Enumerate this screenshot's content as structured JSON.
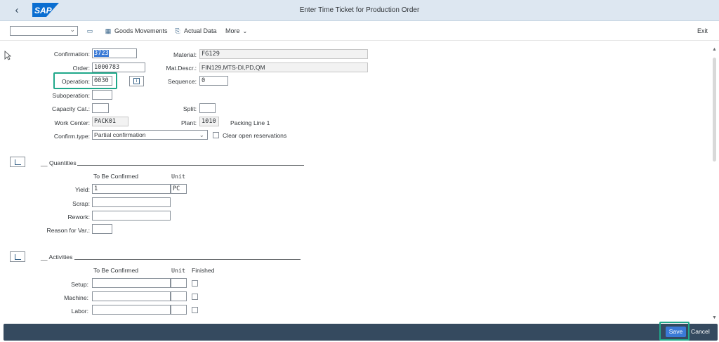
{
  "shell": {
    "title": "Enter Time Ticket for Production Order",
    "logo_text": "SAP",
    "brand_color": "#0a6ed1",
    "back_icon": "back-arrow-icon"
  },
  "toolbar": {
    "variant_value": "",
    "goods_movements": "Goods Movements",
    "actual_data": "Actual Data",
    "more": "More",
    "exit": "Exit"
  },
  "header_fields": {
    "confirmation": {
      "label": "Confirmation:",
      "value": "3723"
    },
    "order": {
      "label": "Order:",
      "value": "1000783"
    },
    "operation": {
      "label": "Operation:",
      "value": "0030"
    },
    "suboperation": {
      "label": "Suboperation:",
      "value": ""
    },
    "capacity_cat": {
      "label": "Capacity Cat.:",
      "value": ""
    },
    "work_center": {
      "label": "Work Center:",
      "value": "PACK01"
    },
    "confirm_type": {
      "label": "Confirm.type:",
      "value": "Partial confirmation"
    },
    "material": {
      "label": "Material:",
      "value": "FG129"
    },
    "mat_descr": {
      "label": "Mat.Descr.:",
      "value": "FIN129,MTS-DI,PD,QM"
    },
    "sequence": {
      "label": "Sequence:",
      "value": "0"
    },
    "split": {
      "label": "Split:",
      "value": ""
    },
    "plant": {
      "label": "Plant:",
      "value": "1010",
      "description": "Packing Line 1"
    },
    "clear_open_reservations": {
      "label": "Clear open reservations",
      "checked": false
    }
  },
  "quantities": {
    "title": "__ Quantities",
    "col_to_be_confirmed": "To Be Confirmed",
    "col_unit": "Unit",
    "yield": {
      "label": "Yield:",
      "value": "1",
      "unit": "PC"
    },
    "scrap": {
      "label": "Scrap:",
      "value": ""
    },
    "rework": {
      "label": "Rework:",
      "value": ""
    },
    "reason_for_var": {
      "label": "Reason for Var.:",
      "value": ""
    }
  },
  "activities": {
    "title": "__ Activities",
    "col_to_be_confirmed": "To Be Confirmed",
    "col_unit": "Unit",
    "col_finished": "Finished",
    "rows": [
      {
        "label": "Setup:",
        "value": "",
        "unit": "",
        "finished": false
      },
      {
        "label": "Machine:",
        "value": "",
        "unit": "",
        "finished": false
      },
      {
        "label": "Labor:",
        "value": "",
        "unit": "",
        "finished": false
      }
    ]
  },
  "footer": {
    "save": "Save",
    "cancel": "Cancel"
  },
  "colors": {
    "shell_bg": "#dde7f1",
    "footer_bg": "#354a5f",
    "emphasized_button": "#3a7ad6",
    "highlight_box": "#20a88a"
  }
}
